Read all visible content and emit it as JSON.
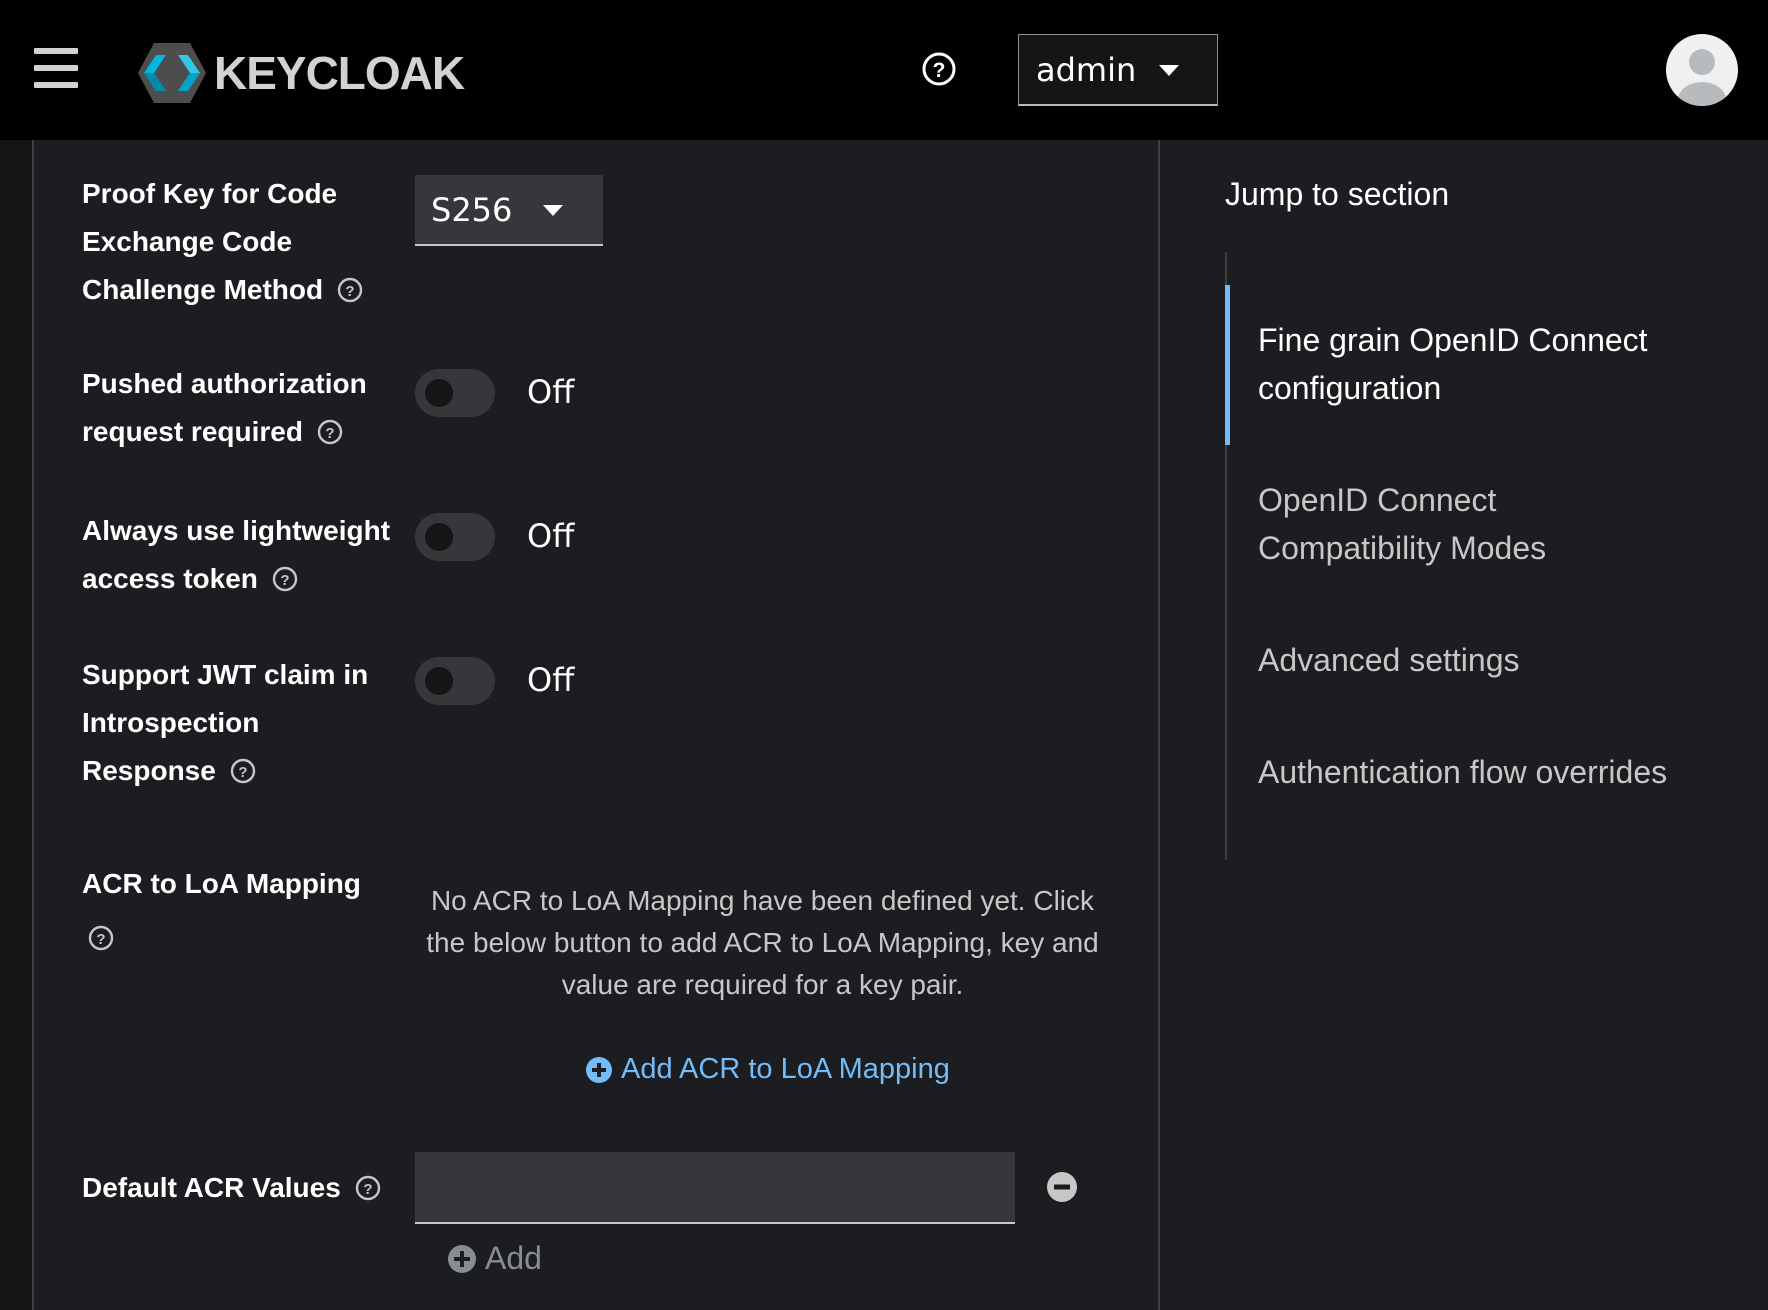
{
  "header": {
    "logo_text": "KEYCLOAK",
    "user_menu": "admin",
    "icons": [
      "menu-icon",
      "help-icon",
      "avatar-icon"
    ]
  },
  "form": {
    "pkce": {
      "label_lines": [
        "Proof Key for Code",
        "Exchange Code",
        "Challenge Method"
      ],
      "value": "S256"
    },
    "par": {
      "label_lines": [
        "Pushed authorization",
        "request required"
      ],
      "state": "Off"
    },
    "lightweight": {
      "label_lines": [
        "Always use lightweight",
        "access token"
      ],
      "state": "Off"
    },
    "jwt_claim": {
      "label_lines": [
        "Support JWT claim in",
        "Introspection",
        "Response"
      ],
      "state": "Off"
    },
    "acr_loa": {
      "label": "ACR to LoA Mapping",
      "empty_message": "No ACR to LoA Mapping have been defined yet. Click the below button to add ACR to LoA Mapping, key and value are required for a key pair.",
      "add_label": "Add ACR to LoA Mapping"
    },
    "default_acr": {
      "label": "Default ACR Values",
      "value": "",
      "add_label": "Add"
    }
  },
  "jump": {
    "title": "Jump to section",
    "items": [
      {
        "lines": [
          "Fine grain OpenID Connect",
          "configuration"
        ],
        "active": true
      },
      {
        "lines": [
          "OpenID Connect",
          "Compatibility Modes"
        ],
        "active": false
      },
      {
        "lines": [
          "Advanced settings"
        ],
        "active": false
      },
      {
        "lines": [
          "Authentication flow overrides"
        ],
        "active": false
      }
    ]
  },
  "colors": {
    "header_bg": "#000000",
    "page_bg": "#1b1d21",
    "link": "#73bcf7",
    "input_bg": "#36373a"
  }
}
